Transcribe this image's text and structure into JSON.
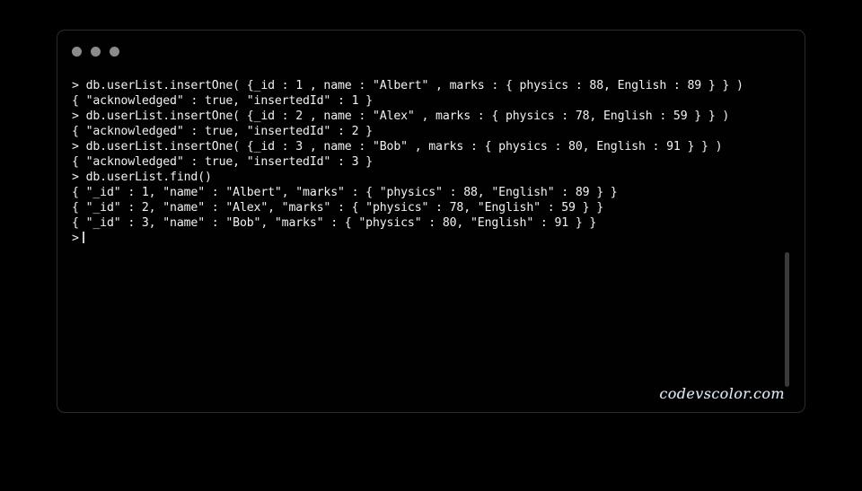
{
  "window": {
    "traffic_lights": [
      {
        "name": "close",
        "color": "#8b8b8b"
      },
      {
        "name": "minimize",
        "color": "#8b8b8b"
      },
      {
        "name": "maximize",
        "color": "#8b8b8b"
      }
    ],
    "background": "#010101",
    "border_color": "#2b2b2b"
  },
  "terminal": {
    "text_color": "#f2f2f2",
    "prompt": ">",
    "lines": [
      "> db.userList.insertOne( {_id : 1 , name : \"Albert\" , marks : { physics : 88, English : 89 } } )",
      "{ \"acknowledged\" : true, \"insertedId\" : 1 }",
      "> db.userList.insertOne( {_id : 2 , name : \"Alex\" , marks : { physics : 78, English : 59 } } )",
      "{ \"acknowledged\" : true, \"insertedId\" : 2 }",
      "> db.userList.insertOne( {_id : 3 , name : \"Bob\" , marks : { physics : 80, English : 91 } } )",
      "{ \"acknowledged\" : true, \"insertedId\" : 3 }",
      "> db.userList.find()",
      "{ \"_id\" : 1, \"name\" : \"Albert\", \"marks\" : { \"physics\" : 88, \"English\" : 89 } }",
      "{ \"_id\" : 2, \"name\" : \"Alex\", \"marks\" : { \"physics\" : 78, \"English\" : 59 } }",
      "{ \"_id\" : 3, \"name\" : \"Bob\", \"marks\" : { \"physics\" : 80, \"English\" : 91 } }"
    ],
    "current_prompt": ">"
  },
  "scrollbar": {
    "thumb_color": "#3a3a3a"
  },
  "watermark": {
    "text": "codevscolor.com",
    "color": "#dce9f5"
  }
}
